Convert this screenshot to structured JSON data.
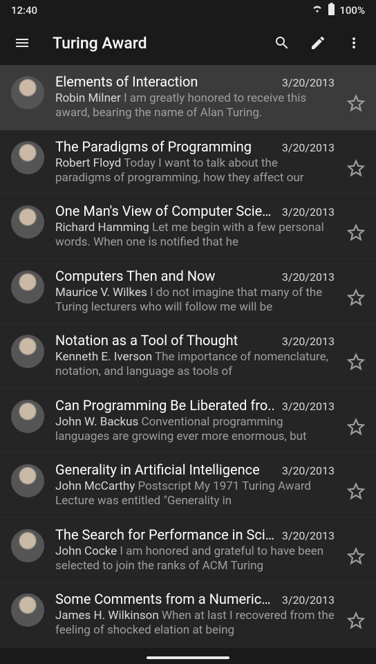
{
  "status": {
    "time": "12:40",
    "battery": "100%"
  },
  "header": {
    "title": "Turing Award"
  },
  "items": [
    {
      "title": "Elements of Interaction",
      "date": "3/20/2013",
      "author": "Robin Milner",
      "preview": "I am greatly honored to receive this award, bearing the name of Alan Turing.",
      "selected": true
    },
    {
      "title": "The Paradigms of Programming",
      "date": "3/20/2013",
      "author": "Robert Floyd",
      "preview": "Today I want to talk about the paradigms of programming, how they affect our",
      "selected": false
    },
    {
      "title": "One Man's View of Computer Scien..",
      "date": "3/20/2013",
      "author": "Richard Hamming",
      "preview": "Let me begin with a few personal words. When one is notified that he",
      "selected": false
    },
    {
      "title": "Computers Then and Now",
      "date": "3/20/2013",
      "author": "Maurice V. Wilkes",
      "preview": "I do not imagine that many of the Turing lecturers who will follow me will be",
      "selected": false
    },
    {
      "title": "Notation as a Tool of Thought",
      "date": "3/20/2013",
      "author": "Kenneth E. Iverson",
      "preview": "The importance of nomenclature, notation, and language as tools of",
      "selected": false
    },
    {
      "title": "Can Programming Be Liberated fro..",
      "date": "3/20/2013",
      "author": "John W. Backus",
      "preview": "Conventional programming languages are growing ever more enormous, but",
      "selected": false
    },
    {
      "title": "Generality in Artificial Intelligence",
      "date": "3/20/2013",
      "author": "John McCarthy",
      "preview": "Postscript My 1971 Turing Award Lecture was entitled \"Generality in",
      "selected": false
    },
    {
      "title": "The Search for Performance in Scie..",
      "date": "3/20/2013",
      "author": "John Cocke",
      "preview": "I am honored and grateful to have been selected to join the ranks of ACM Turing",
      "selected": false
    },
    {
      "title": "Some Comments from a Numerical..",
      "date": "3/20/2013",
      "author": "James H. Wilkinson",
      "preview": "When at last I recovered from the feeling of shocked elation at being",
      "selected": false
    }
  ]
}
